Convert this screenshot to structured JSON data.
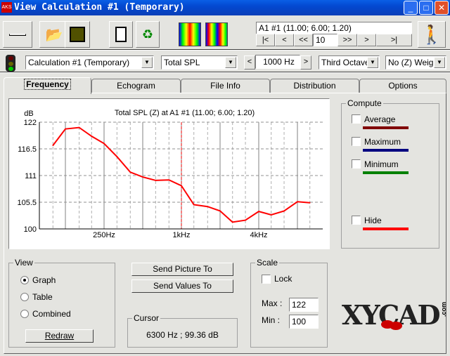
{
  "window": {
    "title": "View Calculation #1 (Temporary)",
    "icon": "app-logo-icon"
  },
  "toolbar": {
    "buttons": [
      "minimize-panel-icon",
      "open-folder-icon",
      "save-disk-icon",
      "notepad-icon",
      "recycle-icon",
      "map-single-icon",
      "map-grid-icon"
    ],
    "receiver": "A1 #1  (11.00; 6.00; 1.20)",
    "nav": [
      "|<",
      "<",
      "<<",
      ">>",
      ">",
      ">|"
    ],
    "nav_value": "10",
    "run_icon": "walking-man-icon"
  },
  "toolbar2": {
    "status_icon": "traffic-light-icon",
    "calculation": "Calculation #1 (Temporary)",
    "quantity": "Total SPL",
    "frequency": "1000 Hz",
    "band": "Third Octave",
    "weighting": "No (Z) Weigh"
  },
  "tabs": [
    {
      "label": "Frequency",
      "active": true
    },
    {
      "label": "Echogram"
    },
    {
      "label": "File Info"
    },
    {
      "label": "Distribution"
    },
    {
      "label": "Options"
    }
  ],
  "compute": {
    "title": "Compute",
    "items": [
      {
        "label": "Average",
        "color": "#800000",
        "checked": false
      },
      {
        "label": "Maximum",
        "color": "#000080",
        "checked": false
      },
      {
        "label": "Minimum",
        "color": "#008000",
        "checked": false
      },
      {
        "label": "Hide",
        "color": "#ff0000",
        "checked": false
      }
    ]
  },
  "view": {
    "title": "View",
    "options": [
      {
        "label": "Graph",
        "selected": true
      },
      {
        "label": "Table",
        "selected": false
      },
      {
        "label": "Combined",
        "selected": false
      }
    ],
    "redraw": "Redraw"
  },
  "send": {
    "picture": "Send Picture To",
    "values": "Send Values To"
  },
  "cursor": {
    "title": "Cursor",
    "value": "6300 Hz ; 99.36 dB"
  },
  "scale": {
    "title": "Scale",
    "lock_label": "Lock",
    "lock": false,
    "max_label": "Max :",
    "max": "122",
    "min_label": "Min :",
    "min": "100"
  },
  "logo": "XYCAD.com",
  "chart_data": {
    "type": "line",
    "title": "Total SPL (Z) at A1 #1  (11.00; 6.00; 1.20)",
    "ylabel": "dB",
    "ylim": [
      100,
      122
    ],
    "xscale": "log",
    "yticks": [
      "122",
      "116.5",
      "111",
      "105.5",
      "100"
    ],
    "xticks": [
      {
        "f": 250,
        "label": "250Hz"
      },
      {
        "f": 1000,
        "label": "1kHz"
      },
      {
        "f": 4000,
        "label": "4kHz"
      }
    ],
    "grid": true,
    "cursor_frequency": 1000,
    "line_color": "#ff0000",
    "x": [
      100,
      125,
      160,
      200,
      250,
      315,
      400,
      500,
      630,
      800,
      1000,
      1250,
      1600,
      2000,
      2500,
      3150,
      4000,
      5000,
      6300,
      8000,
      10000
    ],
    "values": [
      117.2,
      120.6,
      120.9,
      119.1,
      117.6,
      114.9,
      111.7,
      110.7,
      110.0,
      110.1,
      108.9,
      105.0,
      104.6,
      103.7,
      101.4,
      101.8,
      103.6,
      102.9,
      103.7,
      105.6,
      105.4
    ]
  }
}
